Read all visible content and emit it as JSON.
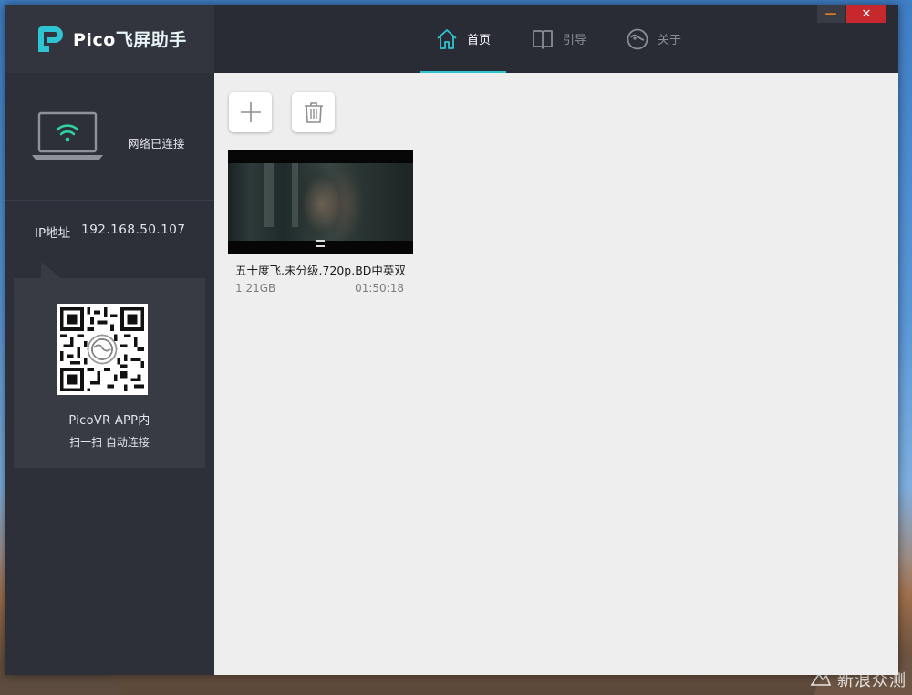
{
  "app": {
    "brand_en": "Pico",
    "brand_cn": "飞屏助手",
    "accent_color": "#2fc4d2"
  },
  "nav": {
    "tabs": [
      {
        "label": "首页",
        "icon": "home-icon",
        "active": true
      },
      {
        "label": "引导",
        "icon": "book-icon",
        "active": false
      },
      {
        "label": "关于",
        "icon": "pico-logo-icon",
        "active": false
      }
    ]
  },
  "window_controls": {
    "minimize": "—",
    "close": "✕"
  },
  "sidebar": {
    "network_status": "网络已连接",
    "ip_label": "IP地址",
    "ip_value": "192.168.50.107",
    "qr_caption_line1": "PicoVR APP内",
    "qr_caption_line2": "扫一扫 自动连接"
  },
  "toolbar": {
    "add_icon": "plus-icon",
    "delete_icon": "trash-icon"
  },
  "videos": [
    {
      "title": "五十度飞.未分级.720p.BD中英双",
      "size": "1.21GB",
      "duration": "01:50:18"
    }
  ],
  "watermark": "新浪众测"
}
